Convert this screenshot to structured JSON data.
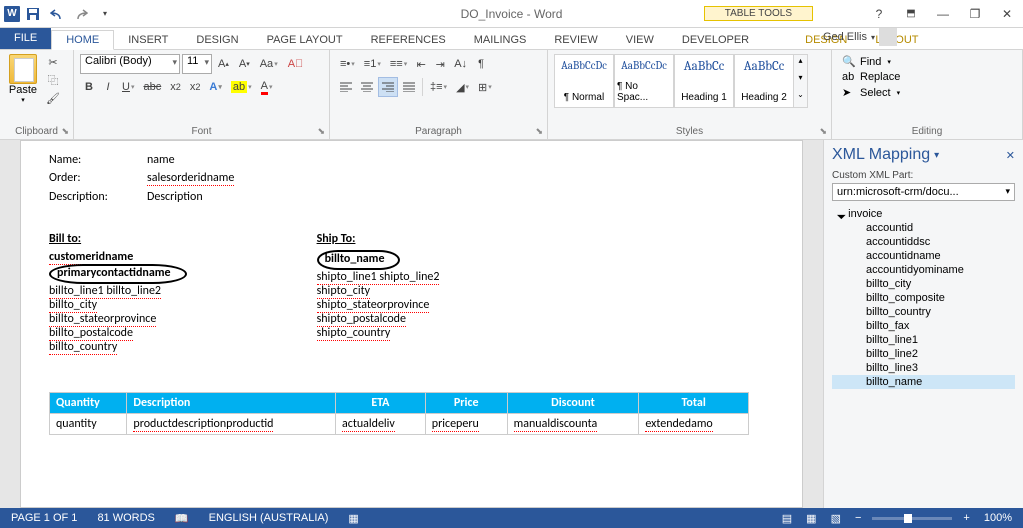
{
  "window": {
    "title": "DO_Invoice - Word",
    "table_tools": "TABLE TOOLS",
    "user": "Ged Ellis"
  },
  "tabs": {
    "file": "FILE",
    "home": "HOME",
    "insert": "INSERT",
    "design": "DESIGN",
    "page_layout": "PAGE LAYOUT",
    "references": "REFERENCES",
    "mailings": "MAILINGS",
    "review": "REVIEW",
    "view": "VIEW",
    "developer": "DEVELOPER",
    "design2": "DESIGN",
    "layout2": "LAYOUT"
  },
  "ribbon": {
    "clipboard": {
      "paste": "Paste",
      "label": "Clipboard"
    },
    "font": {
      "name": "Calibri (Body)",
      "size": "11",
      "label": "Font"
    },
    "paragraph": {
      "label": "Paragraph"
    },
    "styles": {
      "items": [
        {
          "preview": "AaBbCcDc",
          "name": "¶ Normal"
        },
        {
          "preview": "AaBbCcDc",
          "name": "¶ No Spac..."
        },
        {
          "preview": "AaBbCc",
          "name": "Heading 1"
        },
        {
          "preview": "AaBbCc",
          "name": "Heading 2"
        }
      ],
      "label": "Styles"
    },
    "editing": {
      "find": "Find",
      "replace": "Replace",
      "select": "Select",
      "label": "Editing"
    }
  },
  "doc": {
    "rows": [
      {
        "label": "Name:",
        "value": "name"
      },
      {
        "label": "Order:",
        "value": "salesorderidname"
      },
      {
        "label": "Description:",
        "value": "Description"
      }
    ],
    "billto": {
      "title": "Bill to:",
      "lines": [
        "customeridname",
        "primarycontactidname",
        "billto_line1  billto_line2",
        "billto_city",
        "billto_stateorprovince",
        "billto_postalcode",
        "billto_country"
      ]
    },
    "shipto": {
      "title": "Ship To:",
      "lines": [
        "billto_name",
        "shipto_line1  shipto_line2",
        "shipto_city",
        "shipto_stateorprovince",
        "shipto_postalcode",
        "shipto_country"
      ]
    },
    "table": {
      "headers": [
        "Quantity",
        "Description",
        "ETA",
        "Price",
        "Discount",
        "Total"
      ],
      "row": [
        "quantity",
        "productdescriptionproductid",
        "actualdeliv",
        "priceperu",
        "manualdiscounta",
        "extendedamo"
      ]
    }
  },
  "xml": {
    "title": "XML Mapping",
    "sub": "Custom XML Part:",
    "part": "urn:microsoft-crm/docu...",
    "root": "invoice",
    "items": [
      "accountid",
      "accountiddsc",
      "accountidname",
      "accountidyominame",
      "billto_city",
      "billto_composite",
      "billto_country",
      "billto_fax",
      "billto_line1",
      "billto_line2",
      "billto_line3",
      "billto_name"
    ]
  },
  "status": {
    "page": "PAGE 1 OF 1",
    "words": "81 WORDS",
    "lang": "ENGLISH (AUSTRALIA)",
    "zoom": "100%"
  }
}
